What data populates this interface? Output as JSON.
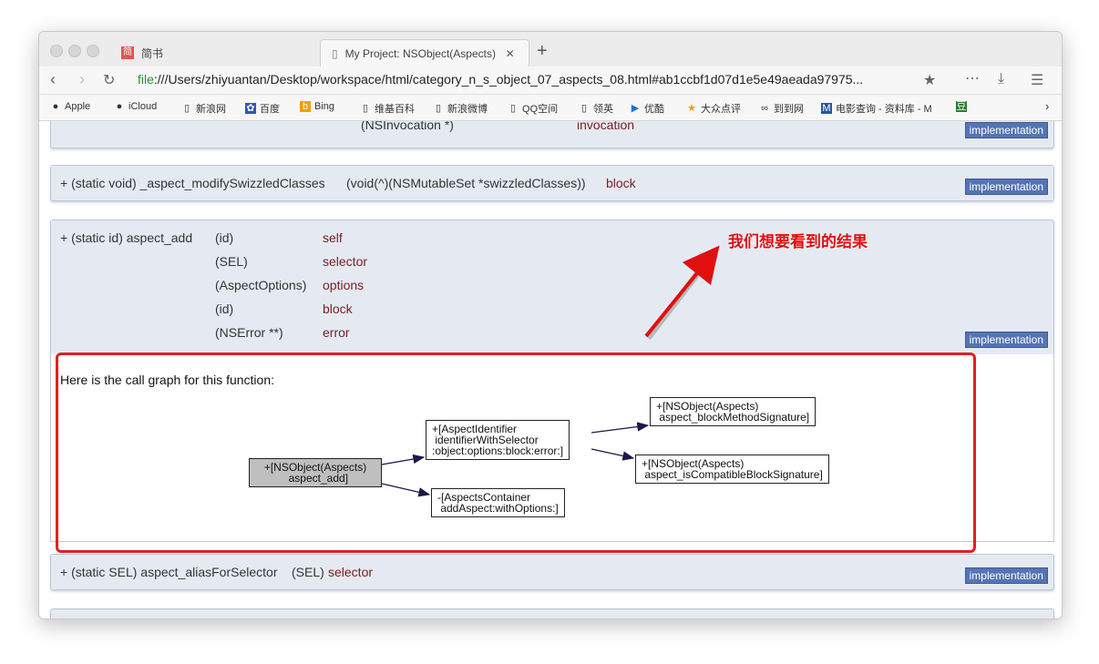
{
  "browser": {
    "tabs": [
      {
        "label": "简书",
        "icon": "jianshu-icon"
      },
      {
        "label": "My Project: NSObject(Aspects) Ca",
        "icon": "page-icon"
      }
    ],
    "url_scheme": "file",
    "url_rest": ":///Users/zhiyuantan/Desktop/workspace/html/category_n_s_object_07_aspects_08.html#ab1ccbf1d07d1e5e49aeada97975...",
    "bookmarks": [
      "Apple",
      "iCloud",
      "新浪网",
      "百度",
      "Bing",
      "维基百科",
      "新浪微博",
      "QQ空间",
      "领英",
      "优酷",
      "大众点评",
      "到到网",
      "电影查询 - 资料库 - M"
    ]
  },
  "cards": {
    "top": {
      "type": "(NSInvocation *)",
      "name": "invocation"
    },
    "modify": {
      "sig": "+ (static void) _aspect_modifySwizzledClasses",
      "ptype": "(void(^)(NSMutableSet *swizzledClasses))",
      "pname": "block"
    },
    "add": {
      "sig": "+ (static id) aspect_add",
      "params": [
        {
          "type": "(id)",
          "name": "self"
        },
        {
          "type": "(SEL)",
          "name": "selector"
        },
        {
          "type": "(AspectOptions)",
          "name": "options"
        },
        {
          "type": "(id)",
          "name": "block"
        },
        {
          "type": "(NSError **)",
          "name": "error"
        }
      ]
    },
    "alias": {
      "sig": "+ (static SEL) aspect_aliasForSelector",
      "ptype": "(SEL)",
      "pname": "selector"
    },
    "impl_label": "implementation"
  },
  "callgraph": {
    "intro": "Here is the call graph for this function:",
    "nodes": {
      "root": "+[NSObject(Aspects)\n  aspect_add]",
      "identifier": "+[AspectIdentifier\n identifierWithSelector\n:object:options:block:error:]",
      "container": "-[AspectsContainer\n addAspect:withOptions:]",
      "blockSig": "+[NSObject(Aspects)\n aspect_blockMethodSignature]",
      "compatible": "+[NSObject(Aspects)\n aspect_isCompatibleBlockSignature]"
    }
  },
  "annotation": "我们想要看到的结果",
  "colors": {
    "accent": "#5574b3",
    "annotation": "#e01010"
  }
}
